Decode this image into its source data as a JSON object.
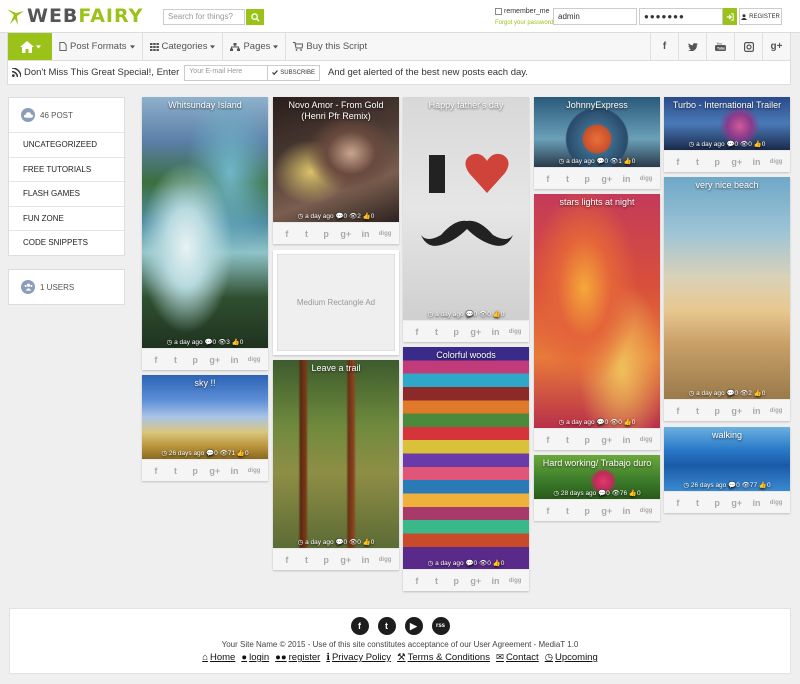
{
  "header": {
    "logo_web": "WEB",
    "logo_fairy": "FAIRY",
    "search_placeholder": "Search for things?",
    "remember_label": "remember_me",
    "forgot_label": "Forgot your password ?",
    "username_value": "admin",
    "password_value": "●●●●●●●",
    "register_label": "REGISTER",
    "accent": "#9bc219"
  },
  "nav": {
    "post_formats": "Post Formats",
    "categories": "Categories",
    "pages": "Pages",
    "buy": "Buy this Script",
    "social": [
      "f",
      "t",
      "yt",
      "ig",
      "g+"
    ]
  },
  "newsletter": {
    "text": "Don't Miss This Great Special!, Enter",
    "placeholder": "Your E-mail Here",
    "subscribe": "SUBSCRIBE",
    "after": "And get alerted of the best new posts each day."
  },
  "sidebar": {
    "post_count": "46 POST",
    "categories": [
      "UNCATEGORIZEED",
      "FREE TUTORIALS",
      "FLASH GAMES",
      "FUN ZONE",
      "CODE SNIPPETS"
    ],
    "users": "1 USERS"
  },
  "share_icons": [
    "f",
    "t",
    "p",
    "g+",
    "in",
    "digg"
  ],
  "ad_label": "Medium Rectangle Ad",
  "posts": [
    {
      "title": "Whitsunday Island",
      "meta": "◷ a day ago 💬0 👁3 👍0"
    },
    {
      "title": "sky !!",
      "meta": "◷ 26 days ago 💬0 👁71 👍0"
    },
    {
      "title": "Novo Amor - From Gold (Henri Pfr Remix)",
      "meta": "◷ a day ago 💬0 👁2 👍0"
    },
    {
      "title": "Leave a trail",
      "meta": "◷ a day ago 💬0 👁0 👍0"
    },
    {
      "title": "Happy father's day",
      "meta": "◷ a day ago 💬0 👁0 👍0"
    },
    {
      "title": "Colorful woods",
      "meta": "◷ a day ago 💬0 👁0 👍0"
    },
    {
      "title": "JohnnyExpress",
      "meta": "◷ a day ago 💬0 👁1 👍0"
    },
    {
      "title": "stars lights at night",
      "meta": "◷ a day ago 💬0 👁0 👍0"
    },
    {
      "title": "Hard working/ Trabajo duro",
      "meta": "◷ 28 days ago 💬0 👁76 👍0"
    },
    {
      "title": "Turbo - International Trailer",
      "meta": "◷ a day ago 💬0 👁0 👍0"
    },
    {
      "title": "very nice beach",
      "meta": "◷ a day ago 💬0 👁2 👍0"
    },
    {
      "title": "walking",
      "meta": "◷ 26 days ago 💬0 👁77 👍0"
    }
  ],
  "footer": {
    "social": [
      "f",
      "t",
      "▶",
      "rss"
    ],
    "copyright": "Your Site Name © 2015 - Use of this site constitutes acceptance of our User Agreement - MediaT 1.0",
    "links": [
      "Home",
      "login",
      "register",
      "Privacy Policy",
      "Terms & Conditions",
      "Contact",
      "Upcoming"
    ]
  }
}
